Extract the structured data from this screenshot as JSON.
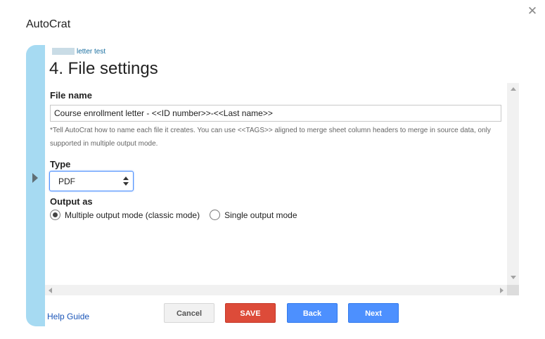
{
  "dialog": {
    "app_title": "AutoCrat",
    "close_icon": "✕"
  },
  "breadcrumb": {
    "job_name": "letter test"
  },
  "step": {
    "title": "4. File settings"
  },
  "file_name": {
    "label": "File name",
    "value": "Course enrollment letter - <<ID number>>-<<Last name>>",
    "help": "*Tell AutoCrat how to name each file it creates. You can use <<TAGS>> aligned to merge sheet column headers to merge in source data, only supported in multiple output mode."
  },
  "type": {
    "label": "Type",
    "selected": "PDF"
  },
  "output": {
    "label": "Output as",
    "options": [
      {
        "label": "Multiple output mode (classic mode)",
        "checked": true
      },
      {
        "label": "Single output mode",
        "checked": false
      }
    ]
  },
  "footer": {
    "help_guide": "Help Guide",
    "cancel": "Cancel",
    "save": "SAVE",
    "back": "Back",
    "next": "Next"
  },
  "colors": {
    "side_tab": "#a6daf2",
    "save": "#dd4b39",
    "primary": "#4d90fe",
    "link": "#1a55b8"
  }
}
